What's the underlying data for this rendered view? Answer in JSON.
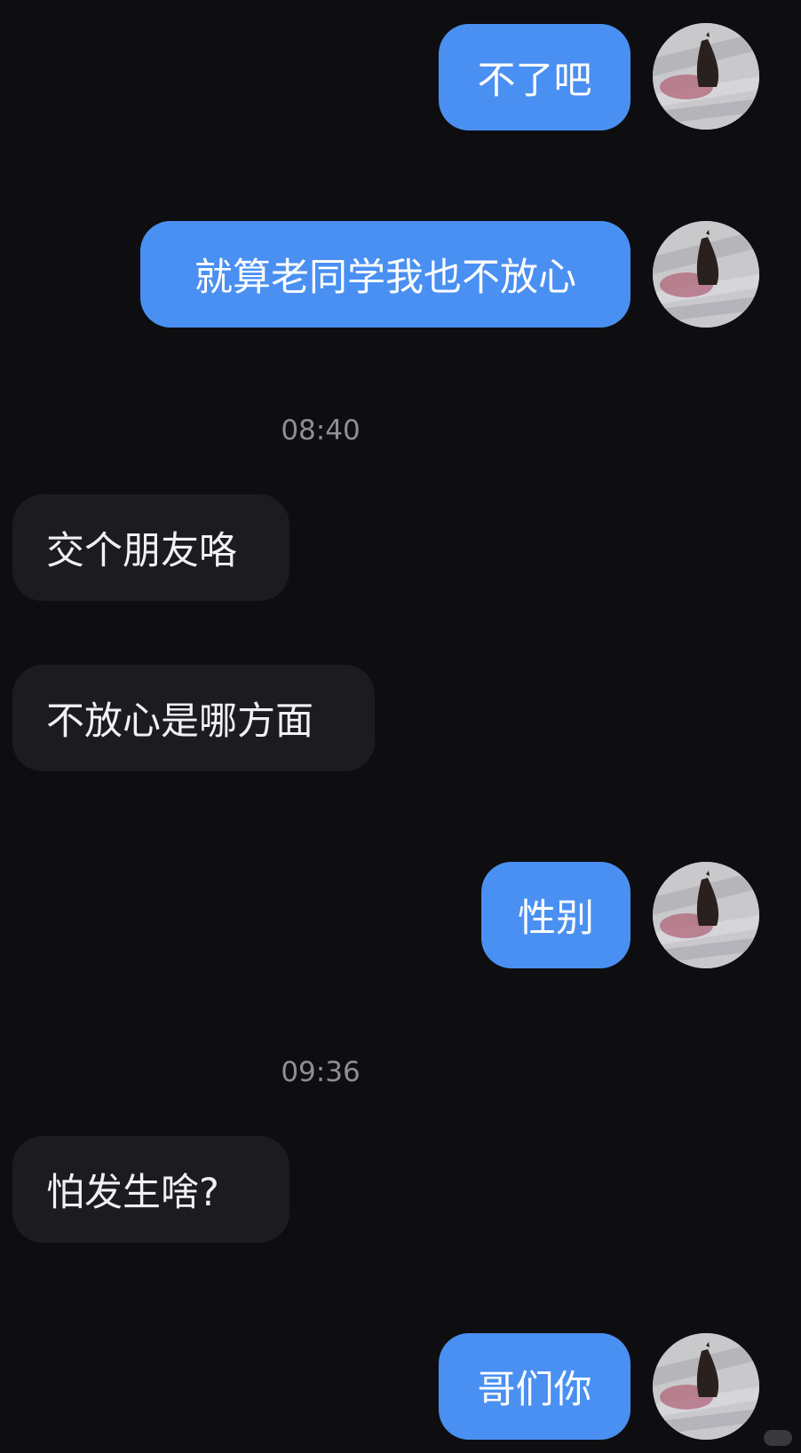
{
  "messages": [
    {
      "text": "不了吧",
      "sender": "me"
    },
    {
      "text": "就算老同学我也不放心",
      "sender": "me"
    },
    {
      "text": "交个朋友咯",
      "sender": "them"
    },
    {
      "text": "不放心是哪方面",
      "sender": "them"
    },
    {
      "text": "性别",
      "sender": "me"
    },
    {
      "text": "怕发生啥?",
      "sender": "them"
    },
    {
      "text": "哥们你",
      "sender": "me"
    }
  ],
  "timestamps": [
    "08:40",
    "09:36"
  ],
  "colors": {
    "background": "#0e0e11",
    "my_bubble": "#4a90f2",
    "their_bubble": "#1c1c20",
    "timestamp": "#8e8e95"
  },
  "avatar": {
    "icon": "butterfly-photo-icon"
  }
}
